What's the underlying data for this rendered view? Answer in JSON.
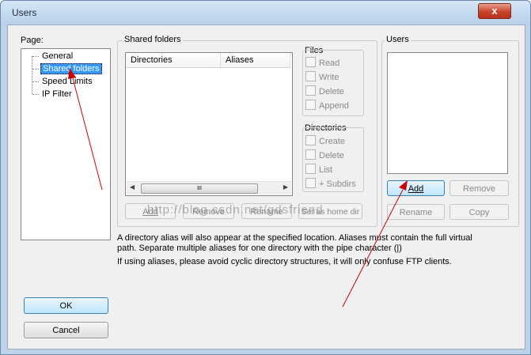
{
  "window": {
    "title": "Users",
    "close_symbol": "x"
  },
  "page_label": "Page:",
  "tree": [
    "General",
    "Shared folders",
    "Speed Limits",
    "IP Filter"
  ],
  "shared_folders": {
    "caption": "Shared folders",
    "columns": [
      "Directories",
      "Aliases"
    ],
    "scroll_thumb": "III",
    "buttons": {
      "add": "Add",
      "remove": "Remove",
      "rename": "Rename",
      "set_home": "Set as home dir"
    }
  },
  "files": {
    "caption": "Files",
    "options": [
      "Read",
      "Write",
      "Delete",
      "Append"
    ]
  },
  "directories": {
    "caption": "Directories",
    "options": [
      "Create",
      "Delete",
      "List",
      "+ Subdirs"
    ]
  },
  "users": {
    "caption": "Users",
    "buttons": {
      "add": "Add",
      "remove": "Remove",
      "rename": "Rename",
      "copy": "Copy"
    }
  },
  "info": {
    "line1": "A directory alias will also appear at the specified location. Aliases must contain the full virtual",
    "line2": "path. Separate multiple aliases for one directory with the pipe character (|)",
    "line3": "If using aliases, please avoid cyclic directory structures, it will only confuse FTP clients."
  },
  "footer": {
    "ok": "OK",
    "cancel": "Cancel"
  },
  "watermark": "http://blog.csdn.net/gdsfriend",
  "colors": {
    "selection": "#3399ff",
    "annotation_arrow": "#cc0000",
    "close_button": "#c7432b"
  }
}
